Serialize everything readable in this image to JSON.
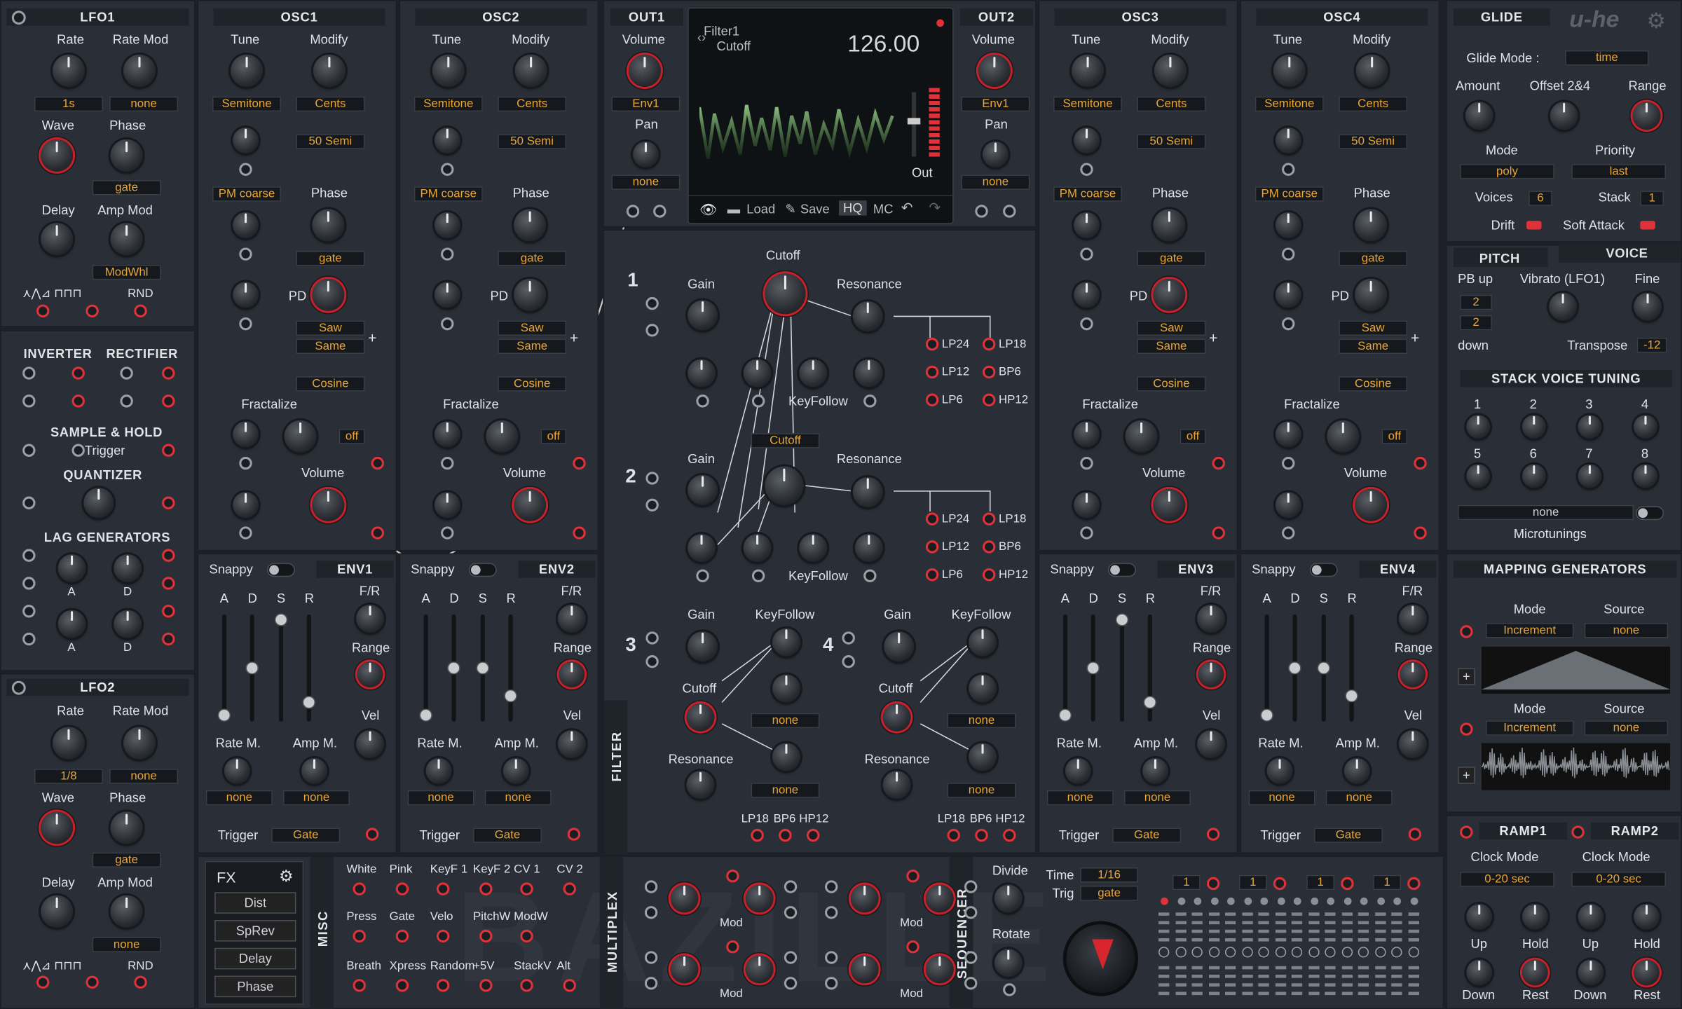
{
  "lfo1": {
    "title": "LFO1",
    "rate": "Rate",
    "rate_mod": "Rate Mod",
    "rate_val": "1s",
    "ratemod_val": "none",
    "wave": "Wave",
    "phase": "Phase",
    "phase_val": "gate",
    "delay": "Delay",
    "amp_mod": "Amp Mod",
    "ampmod_val": "ModWhl",
    "rnd": "RND"
  },
  "lfo2": {
    "title": "LFO2",
    "rate": "Rate",
    "rate_mod": "Rate Mod",
    "rate_val": "1/8",
    "ratemod_val": "none",
    "wave": "Wave",
    "phase": "Phase",
    "phase_val": "gate",
    "delay": "Delay",
    "amp_mod": "Amp Mod",
    "ampmod_val": "none",
    "rnd": "RND"
  },
  "mods": {
    "inverter": "INVERTER",
    "rectifier": "RECTIFIER",
    "sample_hold": "SAMPLE & HOLD",
    "trigger": "Trigger",
    "quantizer": "QUANTIZER",
    "lag": "LAG GENERATORS",
    "a": "A",
    "d": "D"
  },
  "osc": {
    "tune": "Tune",
    "modify": "Modify",
    "semitone": "Semitone",
    "cents": "Cents",
    "semi50": "50 Semi",
    "pm": "PM coarse",
    "phase": "Phase",
    "gate": "gate",
    "pd": "PD",
    "saw": "Saw",
    "same": "Same",
    "cosine": "Cosine",
    "fractalize": "Fractalize",
    "off": "off",
    "volume": "Volume",
    "plus": "+",
    "titles": [
      "OSC1",
      "OSC2",
      "OSC3",
      "OSC4"
    ]
  },
  "out": {
    "out1": "OUT1",
    "out2": "OUT2",
    "volume": "Volume",
    "env1": "Env1",
    "pan": "Pan",
    "none": "none"
  },
  "display": {
    "param": "Filter1",
    "sub": "Cutoff",
    "value": "126.00",
    "out": "Out",
    "load": "Load",
    "save": "Save",
    "hq": "HQ",
    "mc": "MC"
  },
  "filter": {
    "label": "FILTER",
    "gain": "Gain",
    "cutoff": "Cutoff",
    "resonance": "Resonance",
    "keyfollow": "KeyFollow",
    "none": "none",
    "n1": "1",
    "n2": "2",
    "n3": "3",
    "n4": "4",
    "lp24": "LP24",
    "lp18": "LP18",
    "lp12": "LP12",
    "bp6": "BP6",
    "lp6": "LP6",
    "hp12": "HP12"
  },
  "env": {
    "snappy": "Snappy",
    "a": "A",
    "d": "D",
    "s": "S",
    "r": "R",
    "fr": "F/R",
    "range": "Range",
    "vel": "Vel",
    "ratem": "Rate M.",
    "ampm": "Amp M.",
    "none": "none",
    "trigger": "Trigger",
    "gate": "Gate",
    "titles": [
      "ENV1",
      "ENV2",
      "ENV3",
      "ENV4"
    ]
  },
  "glide": {
    "title": "GLIDE",
    "logo": "u-he",
    "mode_label": "Glide Mode :",
    "mode": "time",
    "amount": "Amount",
    "offset": "Offset 2&4",
    "range": "Range",
    "vmode": "Mode",
    "priority": "Priority",
    "poly": "poly",
    "last": "last",
    "voices": "Voices",
    "voices_val": "6",
    "stack": "Stack",
    "stack_val": "1",
    "drift": "Drift",
    "soft": "Soft Attack"
  },
  "pitch": {
    "tab_pitch": "PITCH",
    "tab_voice": "VOICE",
    "pbup": "PB up",
    "vibrato": "Vibrato (LFO1)",
    "fine": "Fine",
    "pb1": "2",
    "pb2": "2",
    "down": "down",
    "transpose": "Transpose",
    "transpose_val": "-12",
    "svt": "STACK VOICE TUNING",
    "nums": [
      "1",
      "2",
      "3",
      "4",
      "5",
      "6",
      "7",
      "8"
    ],
    "none": "none",
    "micro": "Microtunings"
  },
  "mapping": {
    "title": "MAPPING GENERATORS",
    "mode": "Mode",
    "source": "Source",
    "increment": "Increment",
    "none": "none",
    "plus": "+"
  },
  "ramp": {
    "r1": "RAMP1",
    "r2": "RAMP2",
    "clock": "Clock Mode",
    "val": "0-20 sec",
    "up": "Up",
    "hold": "Hold",
    "down": "Down",
    "rest": "Rest"
  },
  "fx": {
    "title": "FX",
    "items": [
      "Dist",
      "SpRev",
      "Delay",
      "Phase"
    ]
  },
  "misc": {
    "label": "MISC",
    "row1": [
      "White",
      "Pink",
      "KeyF 1",
      "KeyF 2",
      "CV 1",
      "CV 2"
    ],
    "row2": [
      "Press",
      "Gate",
      "Velo",
      "PitchW",
      "ModW"
    ],
    "row3": [
      "Breath",
      "Xpress",
      "Random",
      "+5V",
      "StackV",
      "Alt"
    ],
    "watermark": "BAZILLE"
  },
  "multiplex": {
    "label": "MULTIPLEX",
    "mod": "Mod"
  },
  "seq": {
    "label": "SEQUENCER",
    "divide": "Divide",
    "rotate": "Rotate",
    "time": "Time",
    "time_val": "1/16",
    "trig": "Trig",
    "trig_val": "gate",
    "steps": [
      "1",
      "1",
      "1",
      "1"
    ]
  }
}
